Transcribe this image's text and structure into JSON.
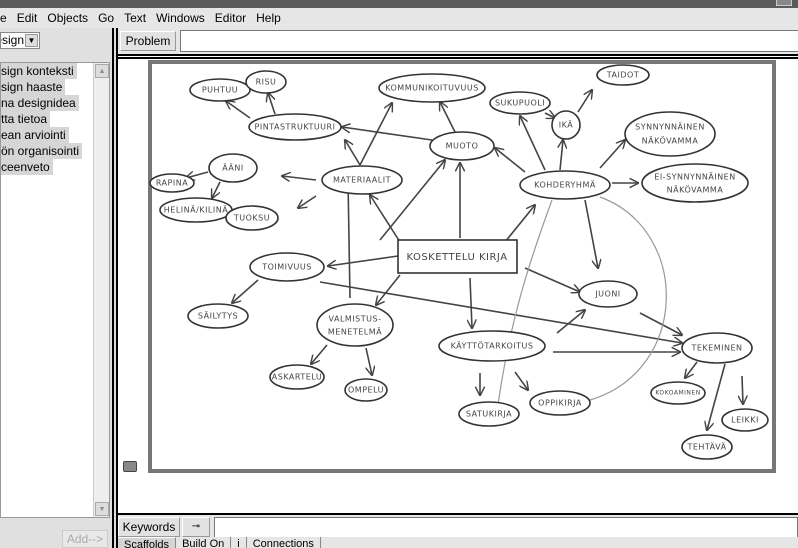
{
  "window": {
    "title": ""
  },
  "menu": [
    "e",
    "Edit",
    "Objects",
    "Go",
    "Text",
    "Windows",
    "Editor",
    "Help"
  ],
  "left_panel": {
    "context_select": "esign",
    "items": [
      "sign konteksti",
      "sign haaste",
      "na designidea",
      "tta tietoa",
      "ean arviointi",
      "ön organisointi",
      "ceenveto"
    ],
    "add_button": "Add-->"
  },
  "toolbar": {
    "problem_button": "Problem",
    "problem_value": ""
  },
  "bottom": {
    "keywords_button": "Keywords",
    "key_button": "⊸",
    "keywords_value": ""
  },
  "tabs": [
    "Scaffolds",
    "Build On",
    "i",
    "Connections"
  ],
  "sketch": {
    "center": "KOSKETTELU KIRJA",
    "nodes": {
      "puhtuu": "PUHTUU",
      "risu": "RISU",
      "pinta": "PINTASTRUKTUURI",
      "kommunikointi": "KOMMUNIKOITUVUUS",
      "muoto": "MUOTO",
      "aani": "ÄÄNI",
      "rapina": "RAPINA",
      "helina": "HELINÄ/KILINÄ",
      "materiaalit": "MATERIAALIT",
      "tuoksu": "TUOKSU",
      "kohderyhma": "KOHDERYHMÄ",
      "sukupuoli": "SUKUPUOLI",
      "ika": "IKÄ",
      "taidot": "TAIDOT",
      "synnynnainen_1": "SYNNYNNÄINEN",
      "synnynnainen_2": "NÄKÖVAMMA",
      "ei_synnynnainen_1": "EI-SYNNYNNÄINEN",
      "ei_synnynnainen_2": "NÄKÖVAMMA",
      "toimivuus": "TOIMIVUUS",
      "sailytys": "SÄILYTYS",
      "valmistus_1": "VALMISTUS-",
      "valmistus_2": "MENETELMÄ",
      "askartelu": "ASKARTELU",
      "ompelu": "OMPELU",
      "kayttotarkoitus": "KÄYTTÖTARKOITUS",
      "juoni": "JUONI",
      "tekeminen": "TEKEMINEN",
      "satukirja": "SATUKIRJA",
      "oppikirja": "OPPIKIRJA",
      "leikki": "LEIKKI",
      "kokoaminen": "KOKOAMINEN",
      "tehtava": "TEHTÄVÄ"
    }
  }
}
